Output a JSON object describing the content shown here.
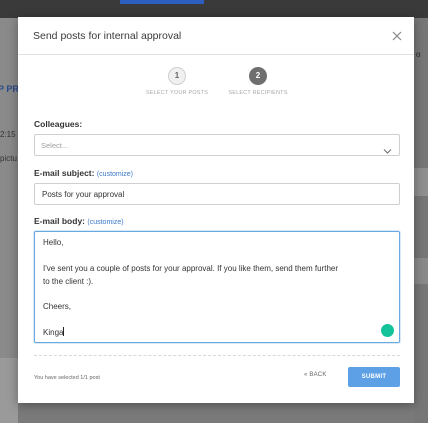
{
  "background": {
    "left_title_fragment": "P PR",
    "left_time_fragment": "2:15",
    "left_text_fragment": "pictu",
    "right_fragment": "o"
  },
  "modal": {
    "title": "Send posts for internal approval",
    "close_icon": "close-icon",
    "steps": [
      {
        "number": "1",
        "label": "SELECT YOUR POSTS",
        "state": "done"
      },
      {
        "number": "2",
        "label": "SELECT RECIPIENTS",
        "state": "active"
      }
    ],
    "colleagues": {
      "label": "Colleagues:",
      "placeholder": "Select...",
      "icon": "chevron-down-icon"
    },
    "subject": {
      "label": "E-mail subject:",
      "customize": "(customize)",
      "value": "Posts for your approval"
    },
    "body": {
      "label": "E-mail body:",
      "customize": "(customize)",
      "lines": {
        "greeting": "Hello,",
        "line1": "I've sent you a couple of posts for your approval. If you like them, send them further",
        "line2": "to the client :).",
        "signoff": "Cheers,",
        "name": "Kinga"
      },
      "assistant_icon": "grammar-assistant-icon"
    },
    "footer": {
      "selected_note": "You have selected 1/1 post",
      "back_label": "« BACK",
      "submit_label": "SUBMIT"
    }
  },
  "colors": {
    "accent": "#5da0e6",
    "link": "#3a78c9",
    "focus_border": "#6aa8e0",
    "grammar_icon": "#15c39a",
    "overlay": "#6e6e6e"
  }
}
